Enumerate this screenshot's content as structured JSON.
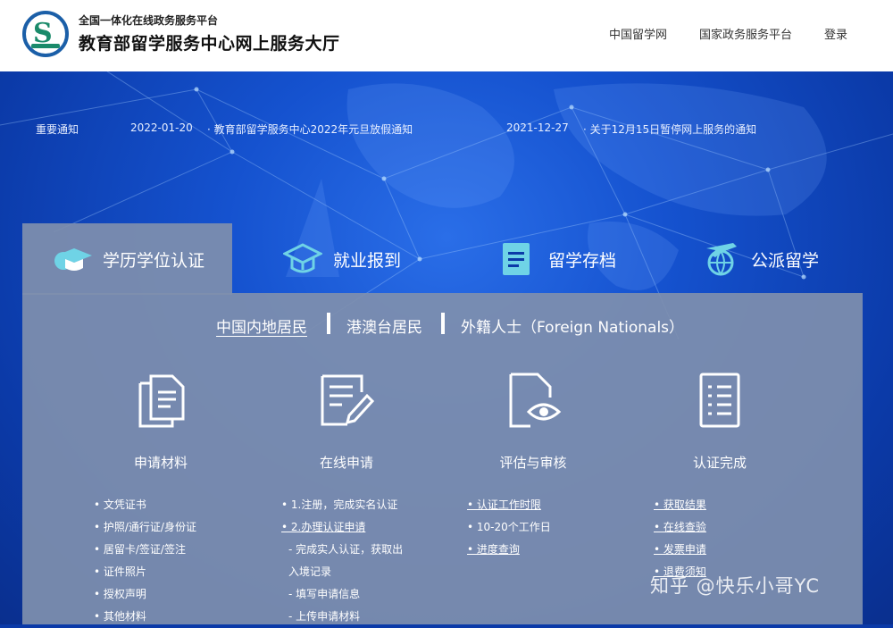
{
  "header": {
    "platform_subtitle": "全国一体化在线政务服务平台",
    "site_title": "教育部留学服务中心网上服务大厅",
    "nav": [
      "中国留学网",
      "国家政务服务平台",
      "登录"
    ]
  },
  "notices": {
    "label": "重要通知",
    "items": [
      {
        "date": "2022-01-20",
        "text": "· 教育部留学服务中心2022年元旦放假通知"
      },
      {
        "date": "2021-12-27",
        "text": "· 关于12月15日暂停网上服务的通知"
      }
    ]
  },
  "tabs": [
    {
      "label": "学历学位认证",
      "icon": "graduation-cap-icon",
      "active": true
    },
    {
      "label": "就业报到",
      "icon": "graduation-cap-outline-icon"
    },
    {
      "label": "留学存档",
      "icon": "document-folder-icon"
    },
    {
      "label": "公派留学",
      "icon": "airplane-globe-icon"
    }
  ],
  "regions": [
    "中国内地居民",
    "港澳台居民",
    "外籍人士（Foreign Nationals）"
  ],
  "steps": [
    {
      "label": "申请材料",
      "icon": "documents-icon",
      "items": [
        "• 文凭证书",
        "• 护照/通行证/身份证",
        "• 居留卡/签证/签注",
        "• 证件照片",
        "• 授权声明",
        "• 其他材料"
      ]
    },
    {
      "label": "在线申请",
      "icon": "edit-form-icon",
      "items": [
        "• 1.注册，完成实名认证",
        "• 2.办理认证申请",
        "- 完成实人认证，获取出",
        "入境记录",
        "- 填写申请信息",
        "- 上传申请材料"
      ]
    },
    {
      "label": "评估与审核",
      "icon": "document-eye-icon",
      "items": [
        "• 认证工作时限",
        "• 10-20个工作日",
        "• 进度查询"
      ]
    },
    {
      "label": "认证完成",
      "icon": "checklist-icon",
      "items": [
        "• 获取结果",
        "• 在线查验",
        "• 发票申请",
        "• 退费须知"
      ]
    }
  ],
  "watermark": "知乎 @快乐小哥YC",
  "colors": {
    "hero_blue": "#1552cf",
    "panel_gray": "#7f8fae",
    "logo_blue": "#1b5fa8",
    "logo_green": "#1a8a6a"
  }
}
